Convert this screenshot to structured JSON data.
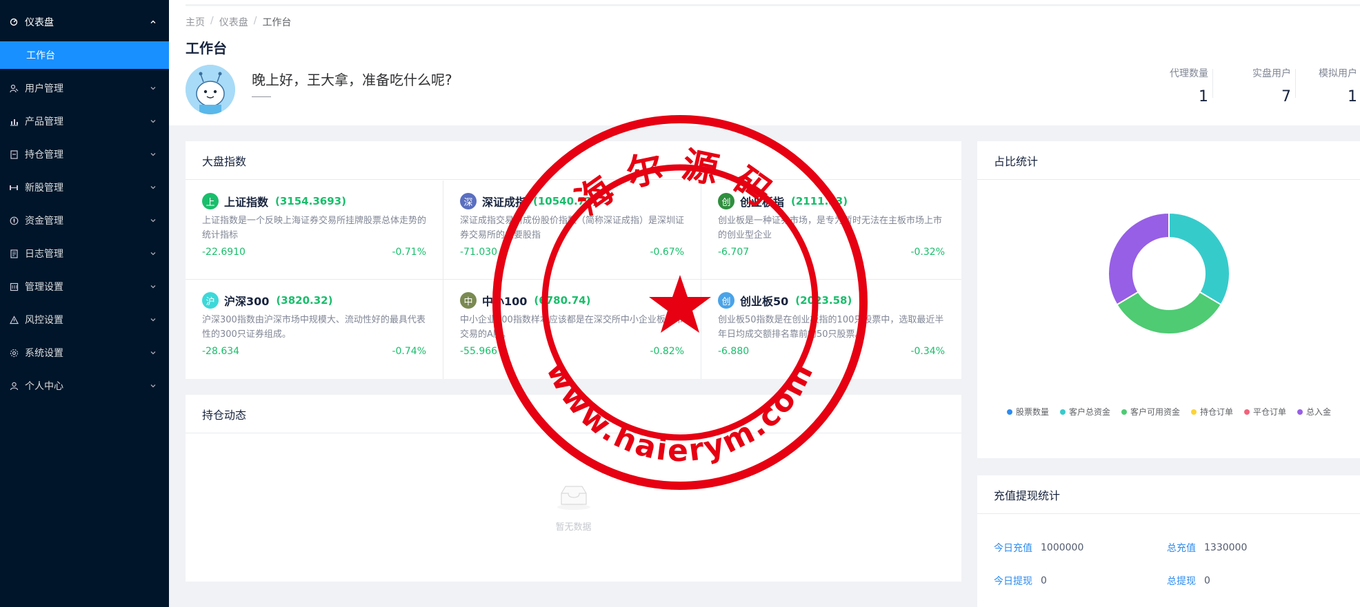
{
  "sidebar": {
    "items": [
      {
        "label": "仪表盘",
        "icon": "dashboard-icon",
        "open": true,
        "children": [
          {
            "label": "工作台",
            "active": true
          }
        ]
      },
      {
        "label": "用户管理",
        "icon": "users-icon"
      },
      {
        "label": "产品管理",
        "icon": "chart-icon"
      },
      {
        "label": "持仓管理",
        "icon": "position-icon"
      },
      {
        "label": "新股管理",
        "icon": "dumbbell-icon"
      },
      {
        "label": "资金管理",
        "icon": "money-icon"
      },
      {
        "label": "日志管理",
        "icon": "log-icon"
      },
      {
        "label": "管理设置",
        "icon": "admin-settings-icon"
      },
      {
        "label": "风控设置",
        "icon": "warning-icon"
      },
      {
        "label": "系统设置",
        "icon": "gear-icon"
      },
      {
        "label": "个人中心",
        "icon": "person-icon"
      }
    ]
  },
  "breadcrumb": {
    "home": "主页",
    "parent": "仪表盘",
    "current": "工作台",
    "sep": "/"
  },
  "page_title": "工作台",
  "greeting": "晚上好，王大拿，准备吃什么呢?",
  "stats": [
    {
      "label": "代理数量",
      "value": "1"
    },
    {
      "label": "实盘用户",
      "value": "7"
    },
    {
      "label": "模拟用户",
      "value": "1"
    }
  ],
  "market": {
    "title": "大盘指数",
    "indices": [
      {
        "badge": "上",
        "badge_color": "#19be6b",
        "name": "上证指数",
        "price": "(3154.3693)",
        "desc": "上证指数是一个反映上海证券交易所挂牌股票总体走势的统计指标",
        "change": "-22.6910",
        "pct": "-0.71%"
      },
      {
        "badge": "深",
        "badge_color": "#5a6fc0",
        "name": "深证成指",
        "price": "(10540.71)",
        "desc": "深证成指交易所成份股价指数（简称深证成指）是深圳证券交易所的主要股指",
        "change": "-71.030",
        "pct": "-0.67%"
      },
      {
        "badge": "创",
        "badge_color": "#2f8f3e",
        "name": "创业板指",
        "price": "(2111.33)",
        "desc": "创业板是一种证券市场，是专为暂时无法在主板市场上市的创业型企业",
        "change": "-6.707",
        "pct": "-0.32%"
      },
      {
        "badge": "沪",
        "badge_color": "#3ed8d8",
        "name": "沪深300",
        "price": "(3820.32)",
        "desc": "沪深300指数由沪深市场中规模大、流动性好的最具代表性的300只证券组成。",
        "change": "-28.634",
        "pct": "-0.74%"
      },
      {
        "badge": "中",
        "badge_color": "#7a8a52",
        "name": "中小100",
        "price": "(6780.74)",
        "desc": "中小企业100指数样本应该都是在深交所中小企业板上市交易的A股。",
        "change": "-55.966",
        "pct": "-0.82%"
      },
      {
        "badge": "创",
        "badge_color": "#4aa3e8",
        "name": "创业板50",
        "price": "(2023.58)",
        "desc": "创业板50指数是在创业板指的100只股票中，选取最近半年日均成交额排名靠前的50只股票。",
        "change": "-6.880",
        "pct": "-0.34%"
      }
    ]
  },
  "holdings": {
    "title": "持仓动态",
    "empty_text": "暂无数据"
  },
  "ratio": {
    "title": "占比统计",
    "legend": [
      {
        "name": "股票数量",
        "color": "#2d8cf0"
      },
      {
        "name": "客户总资金",
        "color": "#36cbcb"
      },
      {
        "name": "客户可用资金",
        "color": "#4ecb73"
      },
      {
        "name": "持仓订单",
        "color": "#fbd437"
      },
      {
        "name": "平仓订单",
        "color": "#f2637b"
      },
      {
        "name": "总入金",
        "color": "#975fe5"
      }
    ]
  },
  "chart_data": {
    "type": "pie",
    "donut": true,
    "categories": [
      "股票数量",
      "客户总资金",
      "客户可用资金",
      "持仓订单",
      "平仓订单",
      "总入金"
    ],
    "values": [
      0,
      1330000,
      1300000,
      0,
      0,
      1330000
    ],
    "colors": [
      "#2d8cf0",
      "#36cbcb",
      "#4ecb73",
      "#fbd437",
      "#f2637b",
      "#975fe5"
    ],
    "legend_position": "bottom"
  },
  "funds": {
    "title": "充值提现统计",
    "rows": [
      {
        "label": "今日充值",
        "value": "1000000"
      },
      {
        "label": "总充值",
        "value": "1330000"
      },
      {
        "label": "今日提现",
        "value": "0"
      },
      {
        "label": "总提现",
        "value": "0"
      }
    ]
  },
  "watermark": {
    "top_text": "海尔源码",
    "bottom_text": "www.haierym.com",
    "color": "#e60012"
  }
}
